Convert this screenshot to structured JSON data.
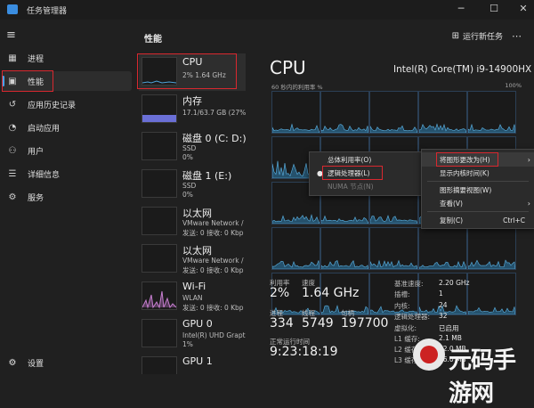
{
  "window": {
    "title": "任务管理器",
    "min_icon": "minimize-icon",
    "max_icon": "maximize-icon",
    "close_icon": "close-icon"
  },
  "sidebar": {
    "items": [
      {
        "label": "进程",
        "icon": "processes-icon"
      },
      {
        "label": "性能",
        "icon": "performance-icon"
      },
      {
        "label": "应用历史记录",
        "icon": "history-icon"
      },
      {
        "label": "启动应用",
        "icon": "startup-icon"
      },
      {
        "label": "用户",
        "icon": "users-icon"
      },
      {
        "label": "详细信息",
        "icon": "details-icon"
      },
      {
        "label": "服务",
        "icon": "services-icon"
      }
    ],
    "settings_label": "设置"
  },
  "header": {
    "title": "性能",
    "run_task_label": "运行新任务"
  },
  "resources": [
    {
      "name": "CPU",
      "sub1": "2% 1.64 GHz"
    },
    {
      "name": "内存",
      "sub1": "17.1/63.7 GB (27%"
    },
    {
      "name": "磁盘 0 (C: D:)",
      "sub1": "SSD",
      "sub2": "0%"
    },
    {
      "name": "磁盘 1 (E:)",
      "sub1": "SSD",
      "sub2": "0%"
    },
    {
      "name": "以太网",
      "sub1": "VMware Network /",
      "sub2": "发送: 0 接收: 0 Kbp"
    },
    {
      "name": "以太网",
      "sub1": "VMware Network /",
      "sub2": "发送: 0 接收: 0 Kbp"
    },
    {
      "name": "Wi-Fi",
      "sub1": "WLAN",
      "sub2": "发送: 0 接收: 0 Kbp"
    },
    {
      "name": "GPU 0",
      "sub1": "Intel(R) UHD Grapt",
      "sub2": "1%"
    },
    {
      "name": "GPU 1",
      "sub1": "",
      "sub2": ""
    }
  ],
  "main": {
    "title": "CPU",
    "model": "Intel(R) Core(TM) i9-14900HX",
    "util_caption": "60 秒内的利用率 %",
    "max_label": "100%"
  },
  "stats": {
    "util_label": "利用率",
    "util_value": "2%",
    "speed_label": "速度",
    "speed_value": "1.64 GHz",
    "proc_label": "进程",
    "proc_value": "334",
    "thread_label": "线程",
    "thread_value": "5749",
    "handle_label": "句柄",
    "handle_value": "197700",
    "uptime_label": "正常运行时间",
    "uptime_value": "9:23:18:19"
  },
  "specs": [
    {
      "label": "基准速度:",
      "value": "2.20 GHz"
    },
    {
      "label": "插槽:",
      "value": "1"
    },
    {
      "label": "内核:",
      "value": "24"
    },
    {
      "label": "逻辑处理器:",
      "value": "32"
    },
    {
      "label": "虚拟化:",
      "value": "已启用"
    },
    {
      "label": "L1 缓存:",
      "value": "2.1 MB"
    },
    {
      "label": "L2 缓存:",
      "value": "32.0 MB"
    },
    {
      "label": "L3 缓存:",
      "value": "36.0 MB"
    }
  ],
  "context_menu": {
    "items": [
      {
        "label": "总体利用率(O)"
      },
      {
        "label": "逻辑处理器(L)"
      },
      {
        "label": "NUMA 节点(N)"
      }
    ]
  },
  "right_menu": {
    "items": [
      {
        "label": "将图形更改为(H)"
      },
      {
        "label": "显示内核时间(K)"
      },
      {
        "label": "图形摘要视图(W)"
      },
      {
        "label": "查看(V)"
      },
      {
        "label": "复制(C)",
        "shortcut": "Ctrl+C"
      }
    ]
  },
  "watermark": {
    "text": "元码手游网"
  },
  "colors": {
    "accent": "#4aa3f0",
    "highlight": "#d9282f",
    "graph": "#4ea3d9"
  }
}
